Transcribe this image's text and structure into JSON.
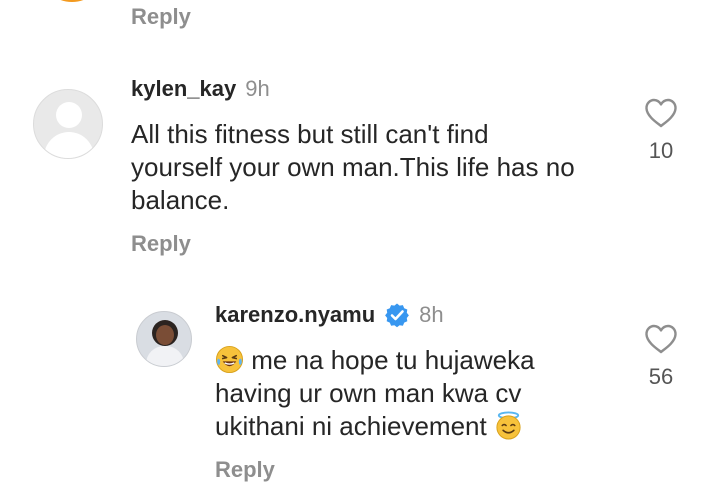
{
  "top": {
    "reply_label": "Reply"
  },
  "comments": [
    {
      "username": "kylen_kay",
      "time": "9h",
      "lines": [
        "All this fitness but still can't find",
        "yourself your own man.This life has no",
        "balance."
      ],
      "reply_label": "Reply",
      "likes": "10",
      "avatar": "default-avatar"
    },
    {
      "username": "karenzo.nyamu",
      "verified": true,
      "time": "8h",
      "lines": [
        "me na hope tu hujaweka",
        "having ur own man kwa cv",
        "ukithani ni achievement"
      ],
      "leading_emoji": "face-with-tears-of-joy",
      "trailing_emoji": "smiling-face-with-halo",
      "reply_label": "Reply",
      "likes": "56",
      "avatar": "profile-photo"
    }
  ],
  "colors": {
    "text": "#262626",
    "muted": "#8e8e8e",
    "verified": "#3897f0",
    "story_ring": "#f39a1f"
  }
}
